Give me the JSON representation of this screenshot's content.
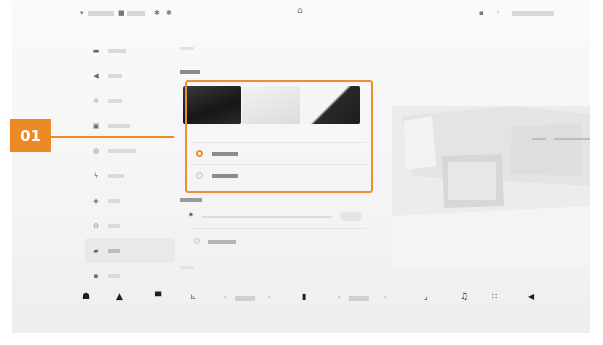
{
  "status_bar": {
    "icons": [
      "signal-icon",
      "wifi-icon",
      "bluetooth-icon",
      "sound-icon",
      "car-icon",
      "mute-icon",
      "temperature-icon"
    ],
    "left_texts": [
      "",
      ""
    ],
    "right_text": ""
  },
  "sidebar": {
    "items": [
      {
        "icon": "display-icon",
        "label": ""
      },
      {
        "icon": "sound-icon",
        "label": ""
      },
      {
        "icon": "light-icon",
        "label": ""
      },
      {
        "icon": "lock-icon",
        "label": ""
      },
      {
        "icon": "driving-icon",
        "label": ""
      },
      {
        "icon": "charging-icon",
        "label": ""
      },
      {
        "icon": "navigation-icon",
        "label": ""
      },
      {
        "icon": "connection-icon",
        "label": ""
      },
      {
        "icon": "system-icon",
        "label": "",
        "active": true
      },
      {
        "icon": "other-icon",
        "label": ""
      }
    ]
  },
  "main": {
    "section_caption": "",
    "theme_title": "",
    "theme_options": [
      {
        "name": "dark-theme",
        "label": ""
      },
      {
        "name": "light-theme",
        "label": ""
      },
      {
        "name": "auto-theme",
        "label": ""
      }
    ],
    "options": [
      {
        "label": "",
        "selected": true
      },
      {
        "label": "",
        "selected": false
      }
    ],
    "brightness_title": "",
    "auto_brightness_label": "",
    "bottom_caption": ""
  },
  "dock": {
    "left_temp": "",
    "right_temp": "",
    "icons": [
      "home-icon",
      "car-icon",
      "seat-icon",
      "fan-icon",
      "defrost-icon",
      "music-icon",
      "apps-icon",
      "volume-icon"
    ]
  },
  "callout": {
    "number": "01",
    "color": "#ec8b23"
  },
  "colors": {
    "accent": "#e8912e",
    "dock_icon": "#1e1e1e"
  }
}
